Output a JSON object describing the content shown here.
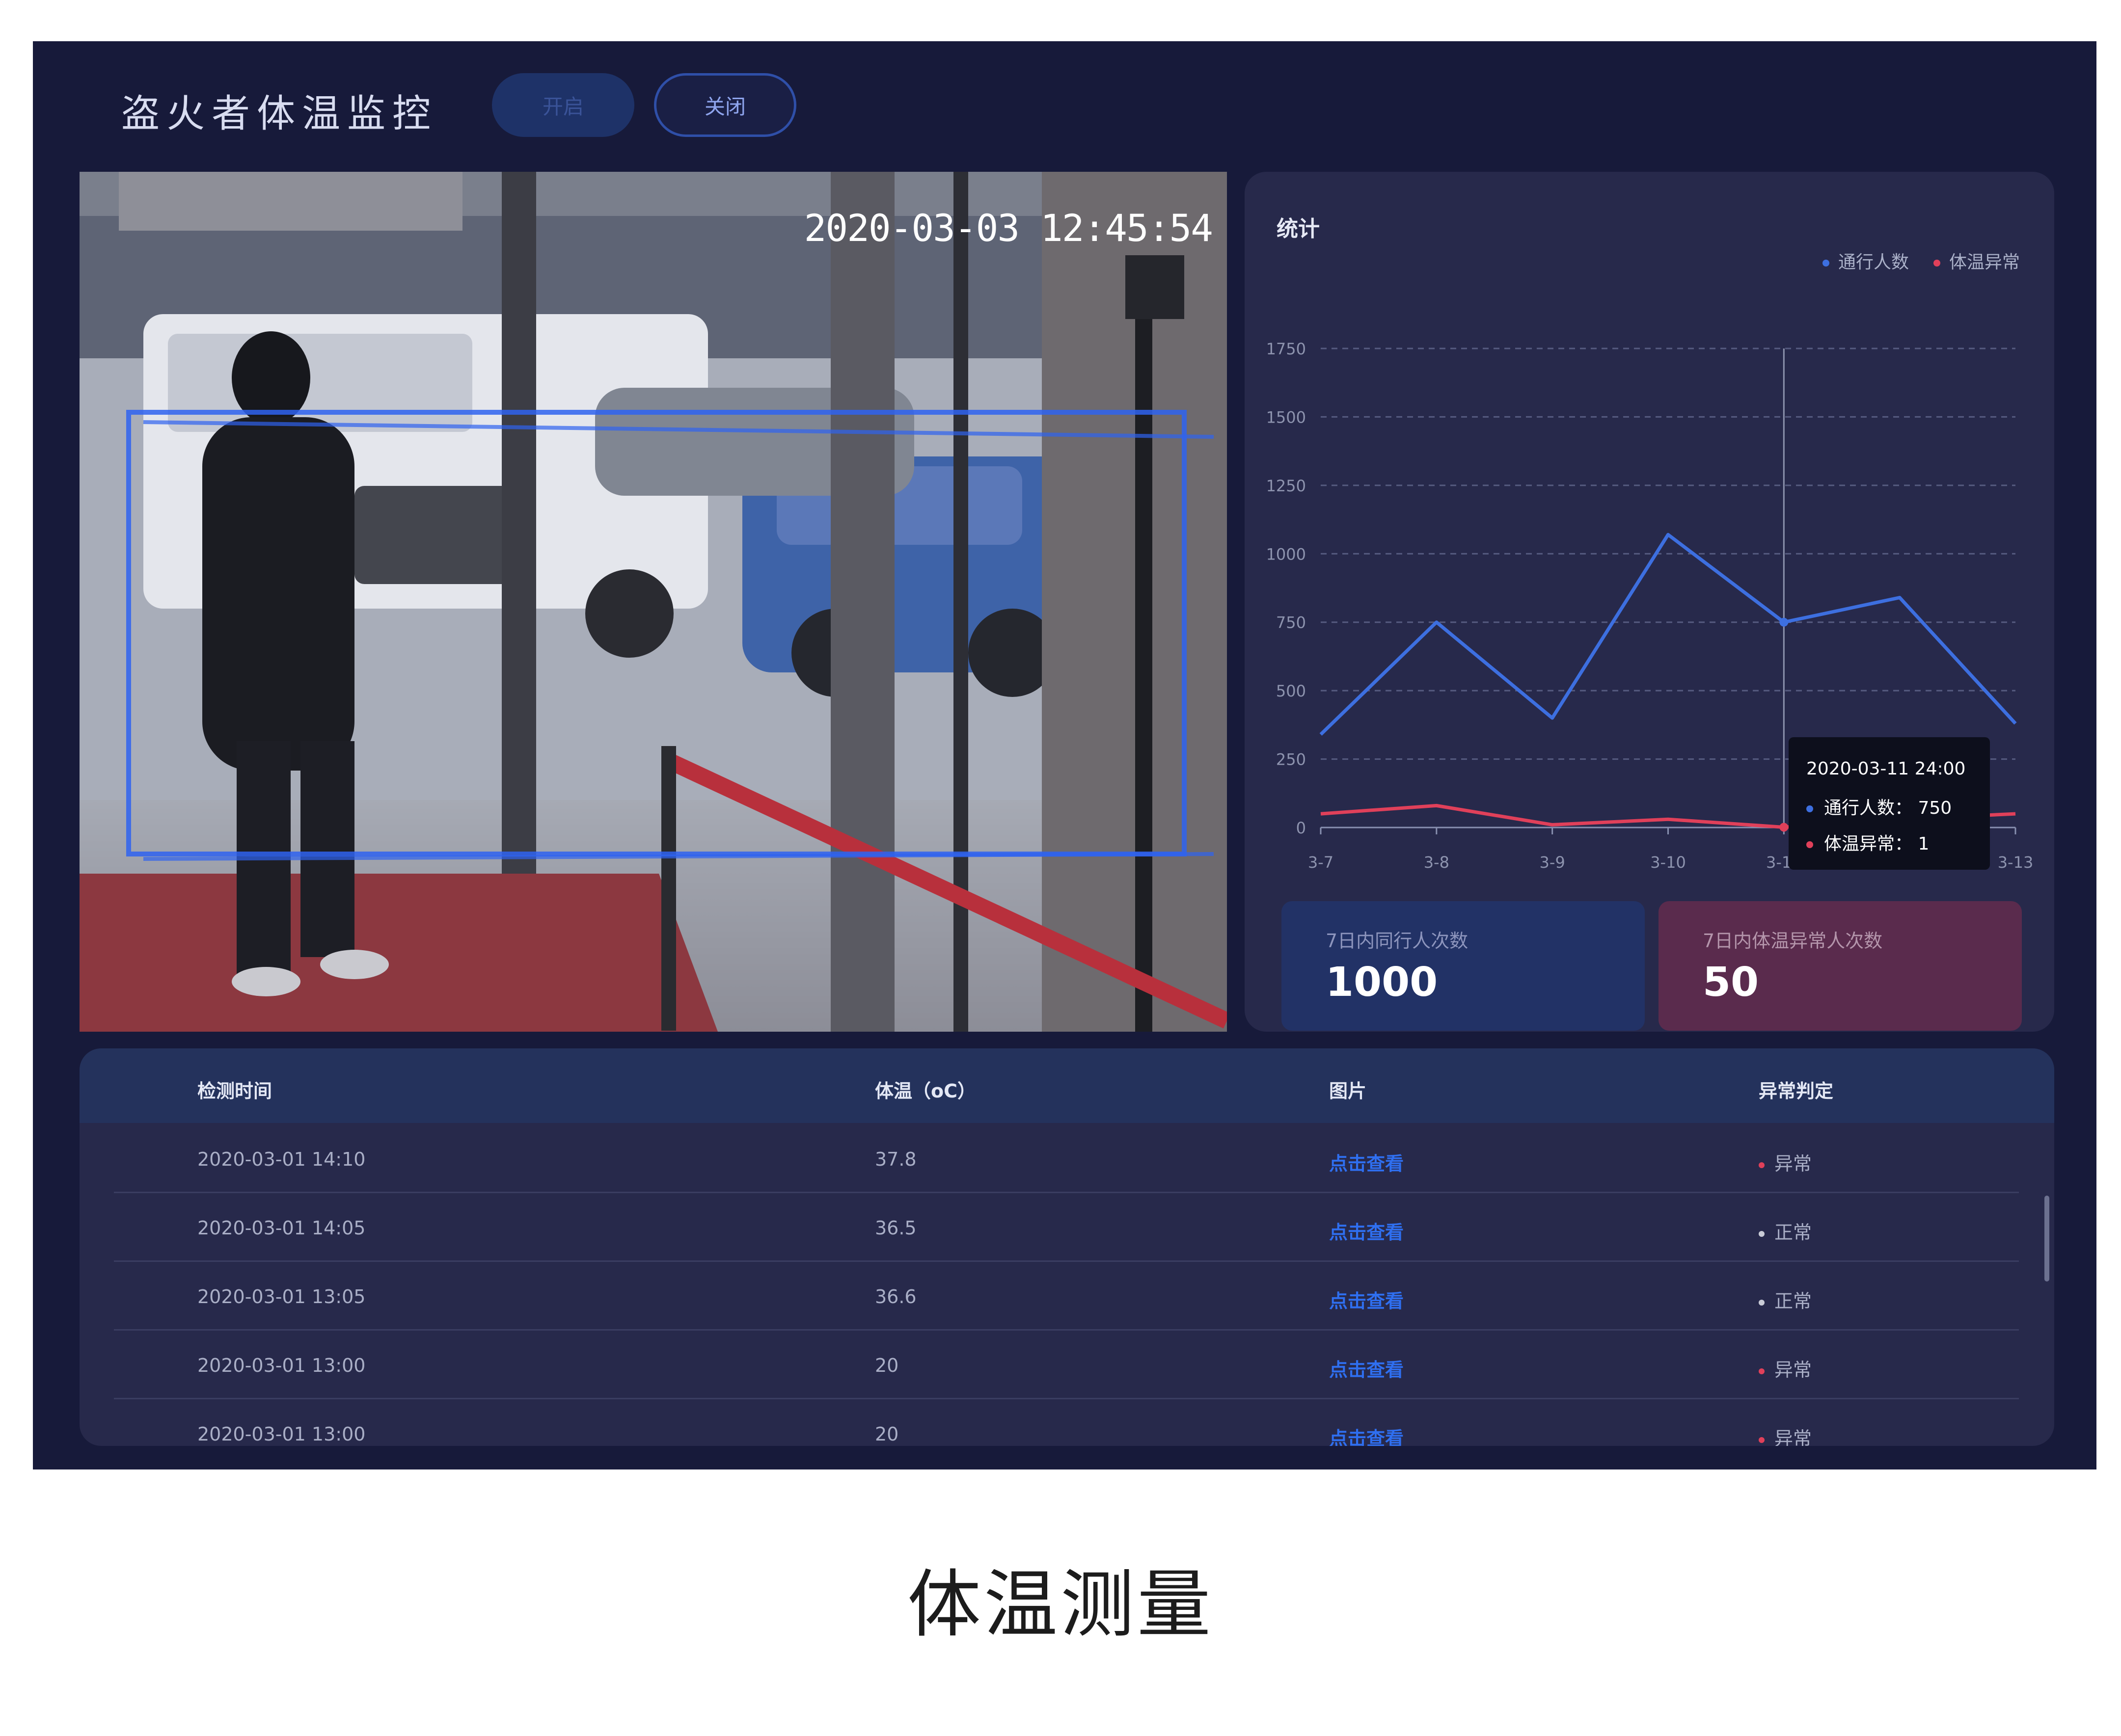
{
  "app": {
    "title": "盗火者体温监控"
  },
  "buttons": {
    "on_label": "开启",
    "off_label": "关闭"
  },
  "camera": {
    "timestamp": "2020-03-03 12:45:54"
  },
  "stats": {
    "title": "统计",
    "legend": [
      {
        "name": "通行人数",
        "color": "#3d6fe0"
      },
      {
        "name": "体温异常",
        "color": "#e0405a"
      }
    ],
    "tooltip": {
      "title": "2020-03-11 24:00",
      "rows": [
        {
          "label": "通行人数：",
          "value": "750",
          "color": "#3d6fe0"
        },
        {
          "label": "体温异常：",
          "value": "1",
          "color": "#e0405a"
        }
      ]
    },
    "kpis": [
      {
        "label": "7日内同行人次数",
        "value": "1000"
      },
      {
        "label": "7日内体温异常人次数",
        "value": "50"
      }
    ]
  },
  "chart_data": {
    "type": "line",
    "categories": [
      "3-7",
      "3-8",
      "3-9",
      "3-10",
      "3-11",
      "3-12",
      "3-13"
    ],
    "series": [
      {
        "name": "通行人数",
        "values": [
          340,
          750,
          400,
          1070,
          750,
          840,
          380
        ],
        "color": "#3d6fe0"
      },
      {
        "name": "体温异常",
        "values": [
          50,
          80,
          10,
          30,
          1,
          30,
          50
        ],
        "color": "#e0405a"
      }
    ],
    "ylim": [
      0,
      1750
    ],
    "yticks": [
      0,
      250,
      500,
      750,
      1000,
      1250,
      1500,
      1750
    ],
    "highlight_category": "3-11",
    "grid": "dashed horizontal",
    "legend_position": "top-right"
  },
  "table": {
    "headers": [
      "检测时间",
      "体温（oC）",
      "图片",
      "异常判定"
    ],
    "rows": [
      {
        "time": "2020-03-01  14:10",
        "temp": "37.8",
        "image": "点击查看",
        "status": "异常",
        "status_color": "#e0405a"
      },
      {
        "time": "2020-03-01  14:05",
        "temp": "36.5",
        "image": "点击查看",
        "status": "正常",
        "status_color": "#c9cbd6"
      },
      {
        "time": "2020-03-01  13:05",
        "temp": "36.6",
        "image": "点击查看",
        "status": "正常",
        "status_color": "#c9cbd6"
      },
      {
        "time": "2020-03-01  13:00",
        "temp": "20",
        "image": "点击查看",
        "status": "异常",
        "status_color": "#e0405a"
      },
      {
        "time": "2020-03-01  13:00",
        "temp": "20",
        "image": "点击查看",
        "status": "异常",
        "status_color": "#e0405a"
      }
    ]
  },
  "caption": "体温测量"
}
